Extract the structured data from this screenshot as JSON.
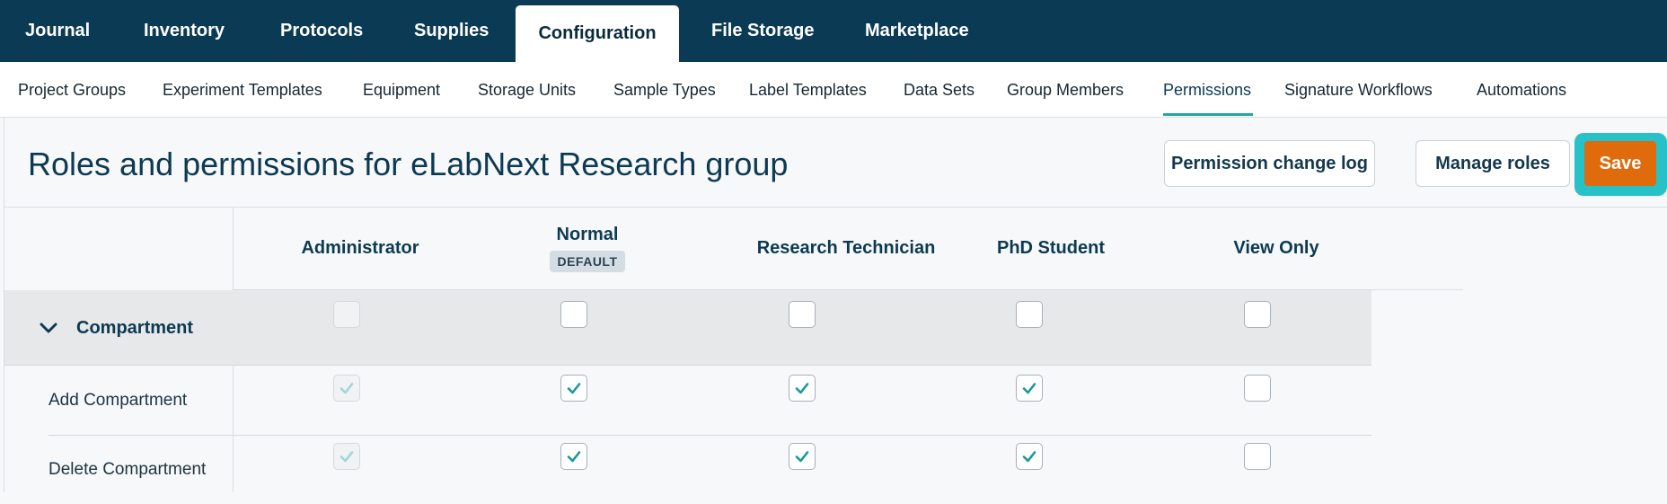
{
  "top_nav": {
    "tabs": [
      "Journal",
      "Inventory",
      "Protocols",
      "Supplies",
      "Configuration",
      "File Storage",
      "Marketplace"
    ],
    "active": "Configuration"
  },
  "sub_nav": {
    "items": [
      "Project Groups",
      "Experiment Templates",
      "Equipment",
      "Storage Units",
      "Sample Types",
      "Label Templates",
      "Data Sets",
      "Group Members",
      "Permissions",
      "Signature Workflows",
      "Automations"
    ],
    "active": "Permissions"
  },
  "page": {
    "title": "Roles and permissions for eLabNext Research group",
    "buttons": {
      "change_log": "Permission change log",
      "manage_roles": "Manage roles",
      "save": "Save"
    }
  },
  "roles": [
    {
      "name": "Administrator",
      "badge": ""
    },
    {
      "name": "Normal",
      "badge": "DEFAULT"
    },
    {
      "name": "Research Technician",
      "badge": ""
    },
    {
      "name": "PhD Student",
      "badge": ""
    },
    {
      "name": "View Only",
      "badge": ""
    }
  ],
  "section": {
    "label": "Compartment",
    "expanded": true,
    "checks": [
      false,
      false,
      false,
      false,
      false
    ],
    "disabled": [
      true,
      false,
      false,
      false,
      false
    ]
  },
  "permissions": [
    {
      "label": "Add Compartment",
      "checks": [
        true,
        true,
        true,
        true,
        false
      ],
      "disabled": [
        true,
        false,
        false,
        false,
        false
      ]
    },
    {
      "label": "Delete Compartment",
      "checks": [
        true,
        true,
        true,
        true,
        false
      ],
      "disabled": [
        true,
        false,
        false,
        false,
        false
      ]
    }
  ],
  "colors": {
    "nav_bg": "#0b3a55",
    "accent_teal": "#1fa7a5",
    "save_orange": "#e06b0c",
    "focus_ring": "#26c2c7"
  }
}
